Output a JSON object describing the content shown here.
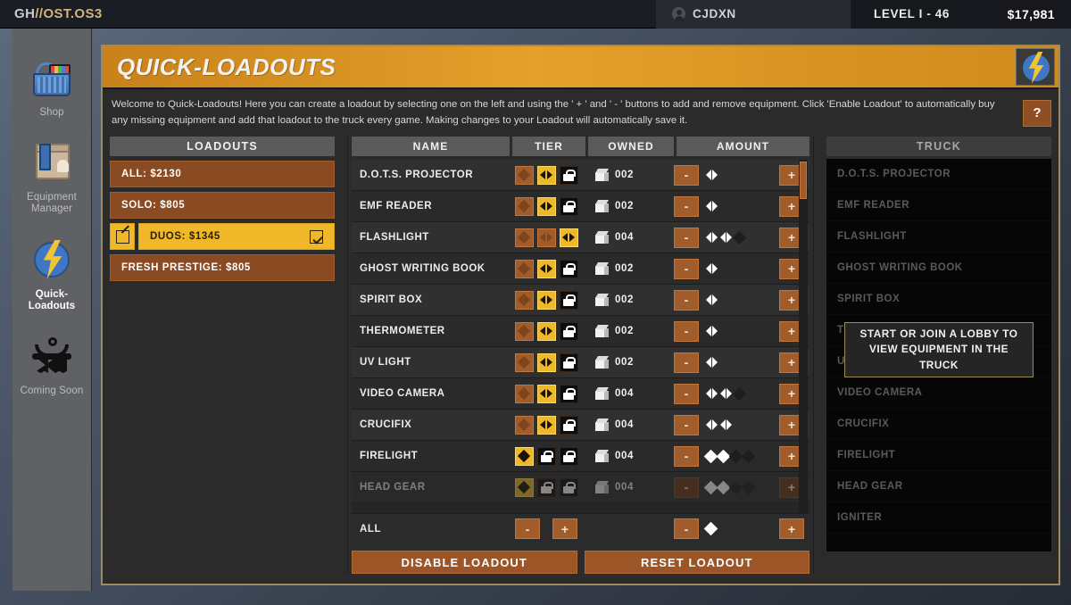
{
  "topbar": {
    "title_part1": "GH",
    "title_part2": "//OST.OS3",
    "user_name": "CJDXN",
    "level": "LEVEL I - 46",
    "money": "$17,981"
  },
  "sidebar": {
    "items": [
      {
        "label": "Shop",
        "icon": "shopping-basket-icon",
        "active": false
      },
      {
        "label": "Equipment Manager",
        "icon": "equipment-box-icon",
        "active": false
      },
      {
        "label": "Quick-Loadouts",
        "icon": "lightning-bolt-icon",
        "active": true
      },
      {
        "label": "Coming Soon",
        "icon": "clothes-hanger-icon",
        "active": false
      }
    ]
  },
  "banner": {
    "title": "QUICK-LOADOUTS",
    "logo_icon": "lightning-bolt-icon"
  },
  "description": {
    "text": "Welcome to Quick-Loadouts! Here you can create a loadout by selecting one on the left and using the ' + ' and ' - ' buttons to add and remove equipment. Click 'Enable Loadout' to automatically buy any missing equipment and add that loadout to the truck every game. Making changes to your Loadout will automatically save it.",
    "help_label": "?"
  },
  "loadouts": {
    "header": "LOADOUTS",
    "items": [
      {
        "label": "ALL: $2130",
        "selected": false
      },
      {
        "label": "SOLO: $805",
        "selected": false
      },
      {
        "label": "DUOS: $1345",
        "selected": true
      },
      {
        "label": "FRESH PRESTIGE: $805",
        "selected": false
      }
    ]
  },
  "table": {
    "headers": {
      "name": "NAME",
      "tier": "TIER",
      "owned": "OWNED",
      "amount": "AMOUNT"
    },
    "rows": [
      {
        "name": "D.O.T.S. PROJECTOR",
        "tiers": [
          "avail",
          "active",
          "locked"
        ],
        "owned": "002",
        "pips": [
          "arrow"
        ],
        "dimmed": false
      },
      {
        "name": "EMF READER",
        "tiers": [
          "avail",
          "active",
          "locked"
        ],
        "owned": "002",
        "pips": [
          "arrow"
        ],
        "dimmed": false
      },
      {
        "name": "FLASHLIGHT",
        "tiers": [
          "avail",
          "avail",
          "active"
        ],
        "owned": "004",
        "pips": [
          "arrow",
          "arrow",
          "diamond-empty"
        ],
        "dimmed": false
      },
      {
        "name": "GHOST WRITING BOOK",
        "tiers": [
          "avail",
          "active",
          "locked"
        ],
        "owned": "002",
        "pips": [
          "arrow"
        ],
        "dimmed": false
      },
      {
        "name": "SPIRIT BOX",
        "tiers": [
          "avail",
          "active",
          "locked"
        ],
        "owned": "002",
        "pips": [
          "arrow"
        ],
        "dimmed": false
      },
      {
        "name": "THERMOMETER",
        "tiers": [
          "avail",
          "active",
          "locked"
        ],
        "owned": "002",
        "pips": [
          "arrow"
        ],
        "dimmed": false
      },
      {
        "name": "UV LIGHT",
        "tiers": [
          "avail",
          "active",
          "locked"
        ],
        "owned": "002",
        "pips": [
          "arrow"
        ],
        "dimmed": false
      },
      {
        "name": "VIDEO CAMERA",
        "tiers": [
          "avail",
          "active",
          "locked"
        ],
        "owned": "004",
        "pips": [
          "arrow",
          "arrow",
          "diamond-empty"
        ],
        "dimmed": false
      },
      {
        "name": "CRUCIFIX",
        "tiers": [
          "avail",
          "active",
          "locked"
        ],
        "owned": "004",
        "pips": [
          "arrow",
          "arrow"
        ],
        "dimmed": false
      },
      {
        "name": "FIRELIGHT",
        "tiers": [
          "active",
          "locked",
          "locked"
        ],
        "owned": "004",
        "pips": [
          "diamond",
          "diamond",
          "diamond-empty",
          "diamond-empty"
        ],
        "dimmed": false
      },
      {
        "name": "HEAD GEAR",
        "tiers": [
          "active",
          "locked",
          "locked"
        ],
        "owned": "004",
        "pips": [
          "diamond",
          "diamond",
          "diamond-empty",
          "diamond-empty"
        ],
        "dimmed": true
      }
    ],
    "all_row": {
      "label": "ALL",
      "minus": "-",
      "plus": "+",
      "pip": "diamond"
    },
    "stepper_minus": "-",
    "stepper_plus": "+"
  },
  "bottom_buttons": {
    "disable": "DISABLE LOADOUT",
    "reset": "RESET LOADOUT"
  },
  "truck": {
    "header": "TRUCK",
    "overlay_message": "START OR JOIN A LOBBY TO VIEW EQUIPMENT IN THE TRUCK",
    "items": [
      "D.O.T.S. PROJECTOR",
      "EMF READER",
      "FLASHLIGHT",
      "GHOST WRITING BOOK",
      "SPIRIT BOX",
      "THERMOMETER",
      "UV LIGHT",
      "VIDEO CAMERA",
      "CRUCIFIX",
      "FIRELIGHT",
      "HEAD GEAR",
      "IGNITER"
    ]
  },
  "colors": {
    "accent_orange": "#a05c2b",
    "accent_yellow": "#f0b828",
    "banner_orange": "#e3a02a",
    "panel_border": "#9e8a5d"
  }
}
